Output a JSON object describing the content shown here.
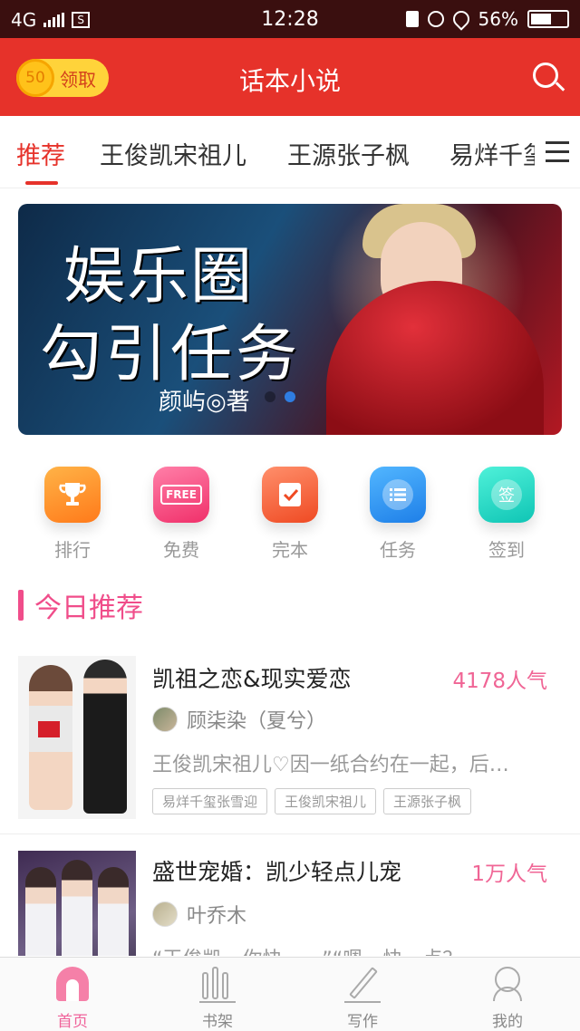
{
  "status_bar": {
    "network": "4G",
    "time": "12:28",
    "battery": "56%"
  },
  "app_bar": {
    "coins": "50",
    "claim_label": "领取",
    "title": "话本小说"
  },
  "tabs": [
    {
      "label": "推荐"
    },
    {
      "label": "王俊凯宋祖儿"
    },
    {
      "label": "王源张子枫"
    },
    {
      "label": "易烊千玺"
    }
  ],
  "banner": {
    "title_line1": "娱乐圈",
    "title_line2": "勾引任务",
    "author": "颜屿◎著",
    "current_slide": 2,
    "slide_count": 2
  },
  "quick_links": [
    {
      "label": "排行",
      "icon": "trophy-icon"
    },
    {
      "label": "免费",
      "icon": "free-icon",
      "badge": "FREE"
    },
    {
      "label": "完本",
      "icon": "check-note-icon"
    },
    {
      "label": "任务",
      "icon": "list-icon"
    },
    {
      "label": "签到",
      "icon": "sign-in-icon",
      "badge": "签"
    }
  ],
  "section": {
    "title": "今日推荐"
  },
  "books": [
    {
      "title": "凯祖之恋&现实爱恋",
      "popularity": "4178人气",
      "author": "顾柒染（夏兮）",
      "description": "王俊凯宋祖儿♡因一纸合约在一起，后…",
      "tags": [
        "易烊千玺张雪迎",
        "王俊凯宋祖儿",
        "王源张子枫"
      ]
    },
    {
      "title": "盛世宠婚：凯少轻点儿宠",
      "popularity": "1万人气",
      "author": "叶乔木",
      "description": "“王俊凯，你快……”“嗯，快一点？…",
      "tags": []
    }
  ],
  "bottom_nav": [
    {
      "label": "首页",
      "icon": "home-icon",
      "active": true
    },
    {
      "label": "书架",
      "icon": "bookshelf-icon"
    },
    {
      "label": "写作",
      "icon": "pen-icon"
    },
    {
      "label": "我的",
      "icon": "profile-icon"
    }
  ],
  "colors": {
    "brand_red": "#e6322a",
    "accent_pink": "#f04d8a",
    "status_bar": "#3a0f0f"
  }
}
